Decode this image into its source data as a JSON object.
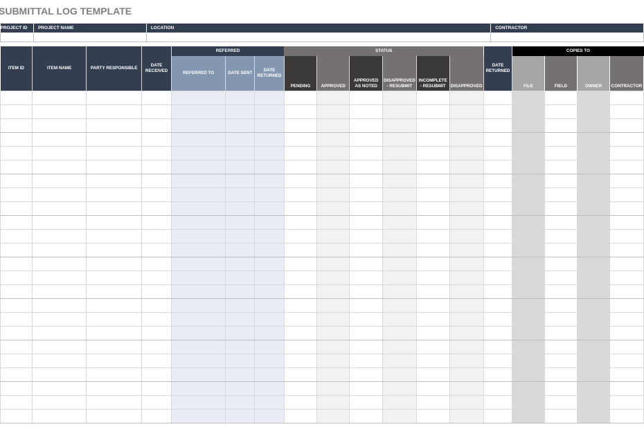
{
  "title": "SUBMITTAL LOG TEMPLATE",
  "project_header": {
    "project_id": "PROJECT ID",
    "project_name": "PROJECT NAME",
    "location": "LOCATION",
    "contractor": "CONTRACTOR"
  },
  "groups": {
    "referred": "REFERRED",
    "status": "STATUS",
    "copies_to": "COPIES TO"
  },
  "columns": {
    "item_id": "ITEM ID",
    "item_name": "ITEM NAME",
    "party_responsible": "PARTY RESPONSIBLE",
    "date_received": "DATE RECEIVED",
    "referred_to": "REFERRED TO",
    "date_sent": "DATE SENT",
    "date_returned_ref": "DATE RETURNED",
    "pending": "PENDING",
    "approved": "APPROVED",
    "approved_as_noted": "APPROVED AS NOTED",
    "disapproved_resubmit": "DISAPPROVED - RESUBMIT",
    "incomplete_resubmit": "INCOMPLETE - RESUBMIT",
    "disapproved": "DISAPPROVED",
    "date_returned": "DATE RETURNED",
    "file": "FILE",
    "field": "FIELD",
    "owner": "OWNER",
    "contractor": "CONTRACTOR"
  },
  "colors": {
    "navy": "#333f50",
    "blue_header": "#8497b0",
    "blue_fill": "#e9edf3",
    "status_dark": "#3b3838",
    "status_gray": "#767171",
    "copies_black": "#000000",
    "copies_light": "#a6a6a6"
  }
}
